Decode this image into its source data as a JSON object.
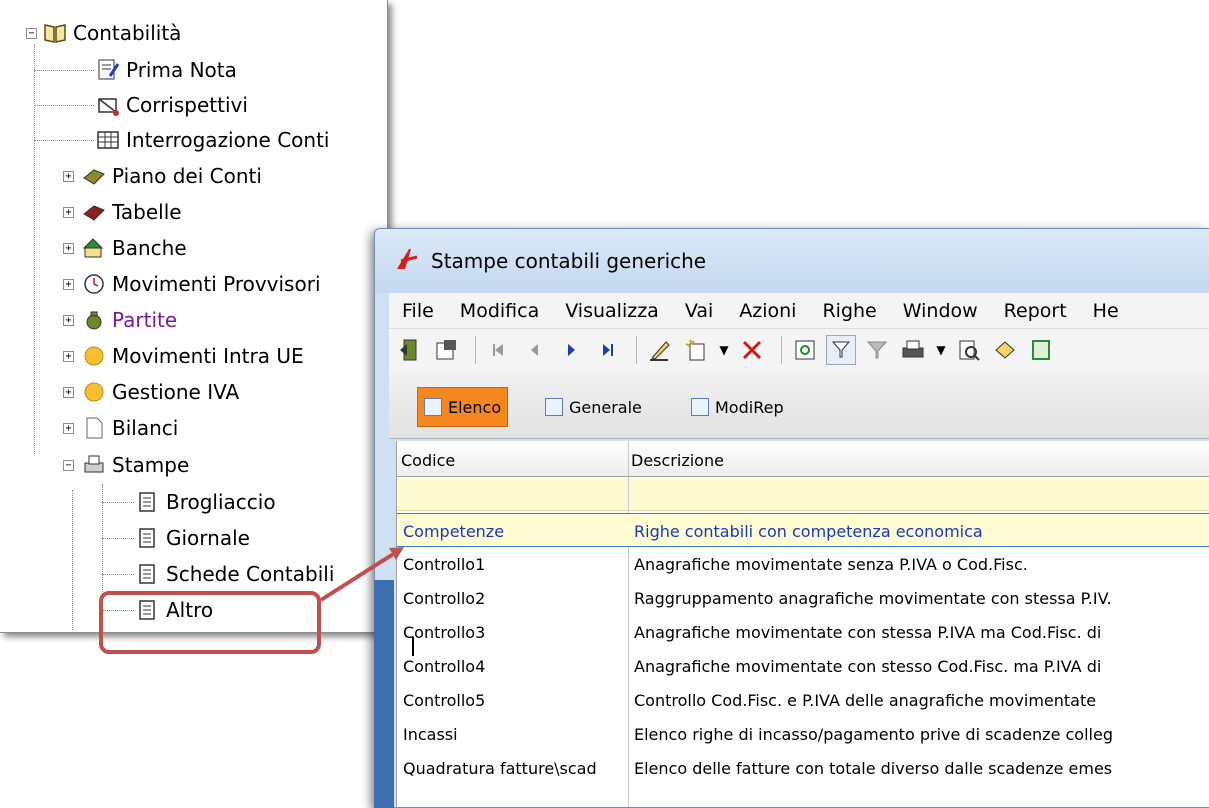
{
  "tree": {
    "root": {
      "label": "Contabilità",
      "expander": "−"
    },
    "items": [
      {
        "label": "Prima Nota",
        "expander": ""
      },
      {
        "label": "Corrispettivi",
        "expander": ""
      },
      {
        "label": "Interrogazione Conti",
        "expander": ""
      },
      {
        "label": "Piano dei Conti",
        "expander": "+"
      },
      {
        "label": "Tabelle",
        "expander": "+"
      },
      {
        "label": "Banche",
        "expander": "+"
      },
      {
        "label": "Movimenti Provvisori",
        "expander": "+"
      },
      {
        "label": "Partite",
        "expander": "+"
      },
      {
        "label": "Movimenti Intra UE",
        "expander": "+"
      },
      {
        "label": "Gestione IVA",
        "expander": "+"
      },
      {
        "label": "Bilanci",
        "expander": "+"
      },
      {
        "label": "Stampe",
        "expander": "−"
      }
    ],
    "stampe_children": [
      "Brogliaccio",
      "Giornale",
      "Schede Contabili",
      "Altro"
    ]
  },
  "window": {
    "title": "Stampe contabili generiche",
    "menu": [
      "File",
      "Modifica",
      "Visualizza",
      "Vai",
      "Azioni",
      "Righe",
      "Window",
      "Report",
      "He"
    ],
    "tabs": [
      "Elenco",
      "Generale",
      "ModiRep"
    ],
    "columns": [
      "Codice",
      "Descrizione"
    ],
    "rows": [
      {
        "code": "Competenze",
        "desc": "Righe contabili con competenza economica"
      },
      {
        "code": "Controllo1",
        "desc": "Anagrafiche movimentate senza P.IVA o Cod.Fisc."
      },
      {
        "code": "Controllo2",
        "desc": "Raggruppamento anagrafiche movimentate con stessa P.IV."
      },
      {
        "code": "Controllo3",
        "desc": "Anagrafiche movimentate con stessa P.IVA ma Cod.Fisc. di"
      },
      {
        "code": "Controllo4",
        "desc": "Anagrafiche movimentate con stesso Cod.Fisc. ma P.IVA di"
      },
      {
        "code": "Controllo5",
        "desc": "Controllo Cod.Fisc. e P.IVA delle anagrafiche movimentate"
      },
      {
        "code": "Incassi",
        "desc": "Elenco righe di incasso/pagamento prive di scadenze colleg"
      },
      {
        "code": "Quadratura fatture\\scad",
        "desc": "Elenco delle fatture con totale diverso dalle scadenze emes"
      }
    ]
  },
  "colors": {
    "accent_tab": "#f6871f",
    "callout": "#c0504d",
    "selection_text": "#1a38b8",
    "partite_label": "#7a1a9a"
  }
}
